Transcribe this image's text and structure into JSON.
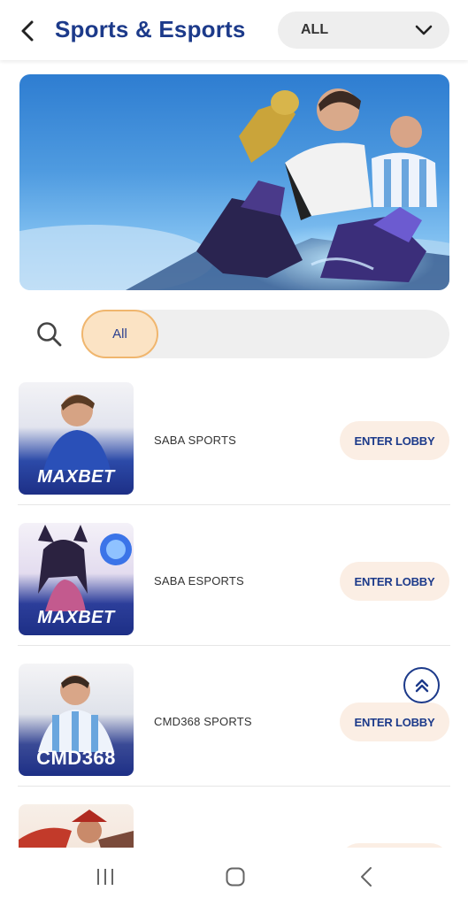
{
  "header": {
    "title": "Sports & Esports",
    "filter": {
      "selected": "ALL"
    }
  },
  "banner": {
    "alt": "banner"
  },
  "category": {
    "active_label": "All"
  },
  "games": [
    {
      "name": "SABA SPORTS",
      "brand": "MAXBET",
      "button": "ENTER LOBBY"
    },
    {
      "name": "SABA ESPORTS",
      "brand": "MAXBET",
      "button": "ENTER LOBBY"
    },
    {
      "name": "CMD368 SPORTS",
      "brand": "CMD368",
      "button": "ENTER LOBBY"
    },
    {
      "name": "",
      "brand": "",
      "button": ""
    }
  ],
  "colors": {
    "brand_blue": "#1c3a8a",
    "pill_bg": "#fbe3c4",
    "pill_border": "#f0b66e",
    "button_bg": "#fbeee4"
  }
}
